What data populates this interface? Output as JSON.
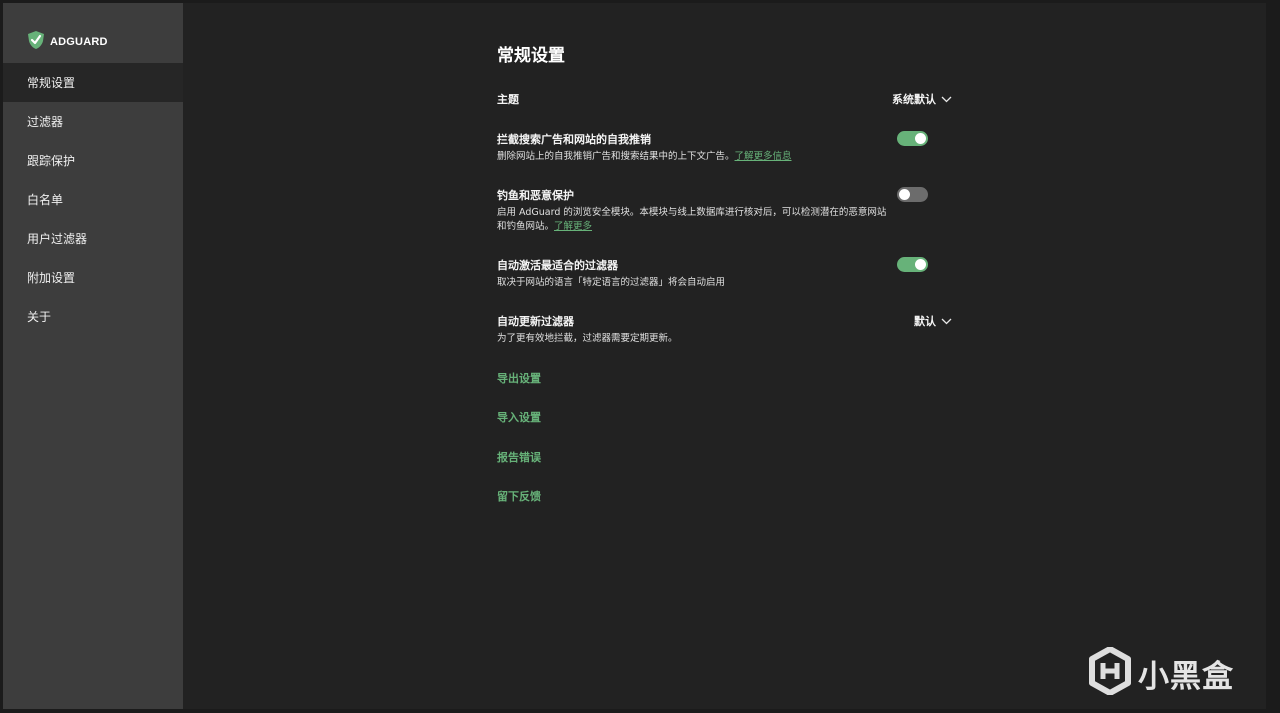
{
  "app": {
    "name": "ADGUARD",
    "accent": "#67b279"
  },
  "sidebar": {
    "items": [
      {
        "label": "常规设置",
        "active": true
      },
      {
        "label": "过滤器"
      },
      {
        "label": "跟踪保护"
      },
      {
        "label": "白名单"
      },
      {
        "label": "用户过滤器"
      },
      {
        "label": "附加设置"
      },
      {
        "label": "关于"
      }
    ]
  },
  "main": {
    "title": "常规设置",
    "theme": {
      "label": "主题",
      "value": "系统默认"
    },
    "self_promo": {
      "title": "拦截搜索广告和网站的自我推销",
      "desc": "删除网站上的自我推销广告和搜索结果中的上下文广告。",
      "link": "了解更多信息",
      "enabled": true
    },
    "phishing": {
      "title": "钓鱼和恶意保护",
      "desc": "启用 AdGuard 的浏览安全模块。本模块与线上数据库进行核对后，可以检测潜在的恶意网站和钓鱼网站。",
      "link": "了解更多",
      "enabled": false
    },
    "auto_filters": {
      "title": "自动激活最适合的过滤器",
      "desc": "取决于网站的语言「特定语言的过滤器」将会自动启用",
      "enabled": true
    },
    "auto_update": {
      "title": "自动更新过滤器",
      "desc": "为了更有效地拦截，过滤器需要定期更新。",
      "value": "默认"
    },
    "actions": {
      "export": "导出设置",
      "import": "导入设置",
      "report": "报告错误",
      "feedback": "留下反馈"
    }
  },
  "watermark": {
    "text": "小黑盒"
  }
}
